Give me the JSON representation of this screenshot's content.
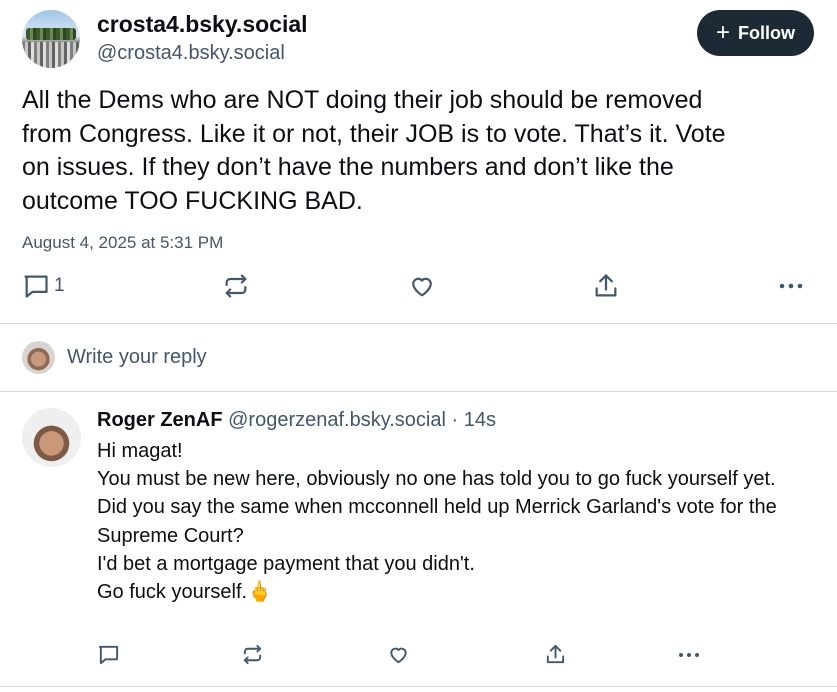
{
  "post": {
    "author_name": "crosta4.bsky.social",
    "author_handle": "@crosta4.bsky.social",
    "follow_label": "Follow",
    "text": "All the Dems who are NOT doing their job should be removed\nfrom Congress. Like it or not,  their JOB is to vote.  That’s it. Vote\non issues.  If they don’t have the numbers and don’t like the\noutcome TOO FUCKING BAD.",
    "date": "August 4, 2025 at 5:31 PM",
    "reply_count": "1"
  },
  "composer": {
    "placeholder": "Write your reply"
  },
  "reply": {
    "author_name": "Roger ZenAF",
    "author_handle": "@rogerzenaf.bsky.social",
    "time": "· 14s",
    "lines": [
      "Hi magat!",
      "You must be new here, obviously no one has told you to go fuck yourself yet.",
      "Did you say the same when mcconnell held up Merrick Garland's vote for the Supreme Court?",
      "I'd bet a mortgage payment that you didn't.",
      "Go fuck yourself.🖕"
    ]
  },
  "icons": {
    "reply": "speech-bubble-icon",
    "repost": "repost-icon",
    "like": "heart-icon",
    "share": "share-icon",
    "more": "ellipsis-icon"
  },
  "colors": {
    "follow_bg": "#1e2936",
    "muted": "#42576c",
    "divider": "#d4dbe2"
  }
}
